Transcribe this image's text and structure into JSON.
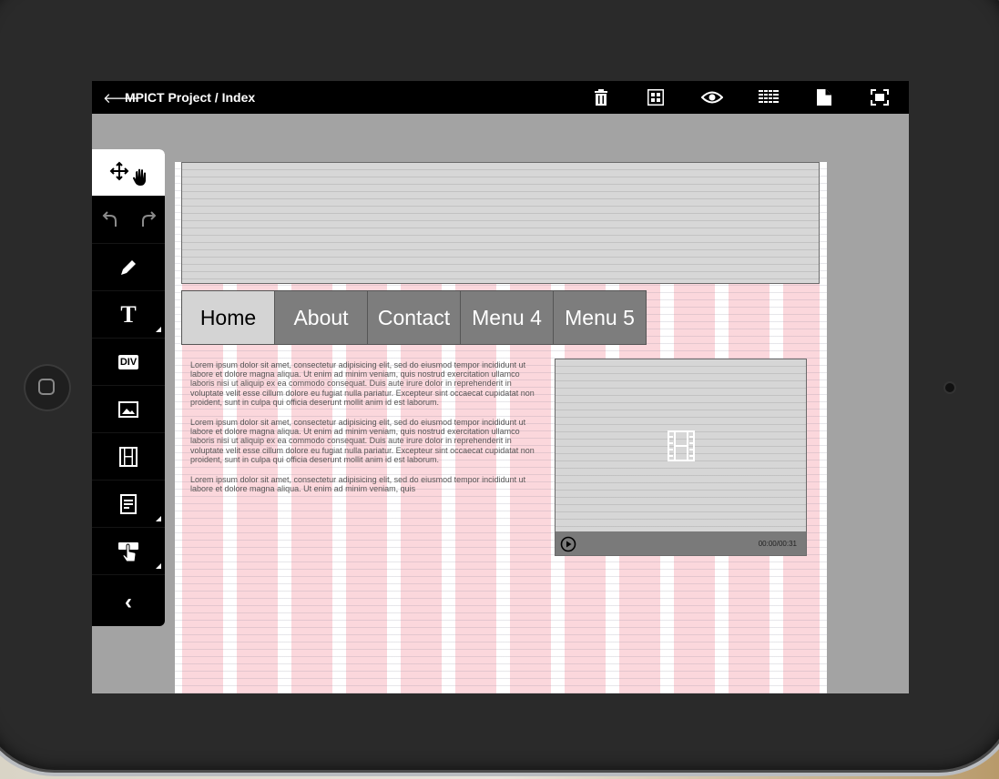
{
  "topbar": {
    "back_icon": "arrow-left-icon",
    "title": "MPICT Project / Index",
    "tools": [
      "trash-icon",
      "grid-preview-icon",
      "eye-icon",
      "columns-grid-icon",
      "document-icon",
      "fullscreen-icon"
    ]
  },
  "palette": {
    "items": [
      "move-hand-icon",
      "undo-redo-icon",
      "pencil-icon",
      "text-icon",
      "div-icon",
      "image-icon",
      "film-icon",
      "form-icon",
      "touch-icon",
      "collapse-icon"
    ],
    "text_label": "T",
    "div_label": "DIV",
    "collapse_label": "‹"
  },
  "nav": {
    "items": [
      "Home",
      "About",
      "Contact",
      "Menu 4",
      "Menu 5"
    ],
    "active": "Home"
  },
  "content": {
    "paragraph_1": "Lorem ipsum dolor sit amet, consectetur adipisicing elit, sed do eiusmod tempor incididunt ut labore et dolore magna aliqua. Ut enim ad minim veniam, quis nostrud exercitation ullamco laboris nisi ut aliquip ex ea commodo consequat. Duis aute irure dolor in reprehenderit in voluptate velit esse cillum dolore eu fugiat nulla pariatur. Excepteur sint occaecat cupidatat non proident, sunt in culpa qui officia deserunt mollit anim id est laborum.",
    "paragraph_2": "Lorem ipsum dolor sit amet, consectetur adipisicing elit, sed do eiusmod tempor incididunt ut labore et dolore magna aliqua. Ut enim ad minim veniam, quis nostrud exercitation ullamco laboris nisi ut aliquip ex ea commodo consequat. Duis aute irure dolor in reprehenderit in voluptate velit esse cillum dolore eu fugiat nulla pariatur. Excepteur sint occaecat cupidatat non proident, sunt in culpa qui officia deserunt mollit anim id est laborum.",
    "paragraph_3": "Lorem ipsum dolor sit amet, consectetur adipisicing elit, sed do eiusmod tempor incididunt ut labore et dolore magna aliqua. Ut enim ad minim veniam, quis"
  },
  "video": {
    "time": "00:00/00:31",
    "icon": "film-icon",
    "play_icon": "play-icon"
  },
  "colors": {
    "grid_column": "#fbd7dc",
    "nav_inactive": "#7d7d7d",
    "nav_active": "#d4d4d4",
    "topbar": "#000000"
  }
}
